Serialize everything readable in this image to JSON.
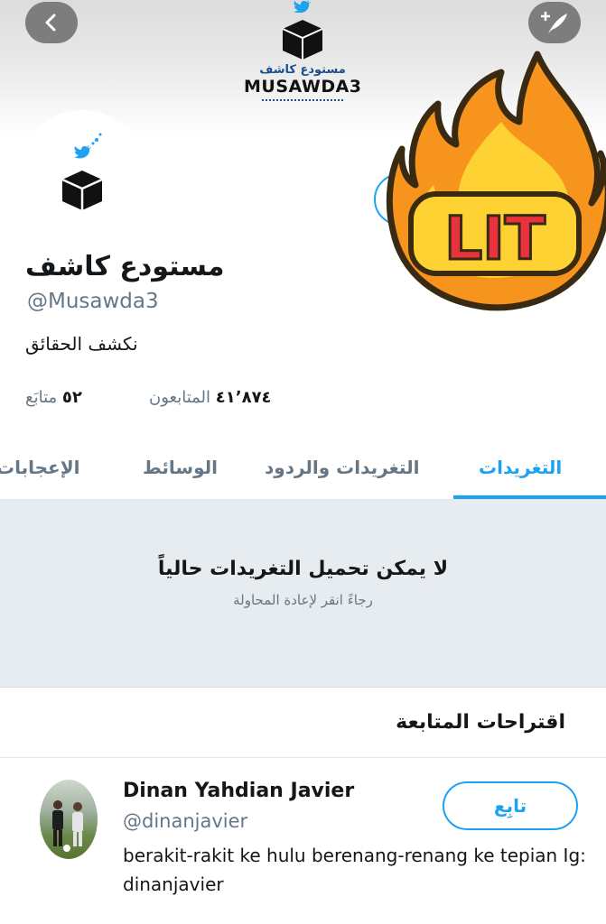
{
  "header": {
    "brand_arabic": "مستودع كاشف",
    "brand_latin": "MUSAWDA3",
    "back_icon": "chevron-left-icon",
    "compose_icon": "compose-tweet-icon"
  },
  "sticker": {
    "text": "LIT"
  },
  "profile": {
    "name": "مستودع كاشف",
    "handle": "@Musawda3",
    "bio": "نكشف الحقائق",
    "following_count": "٥٢",
    "following_label": "متابَع",
    "followers_count": "٤١٬٨٧٤",
    "followers_label": "المتابعون"
  },
  "tabs": [
    {
      "label": "التغريدات",
      "active": true
    },
    {
      "label": "التغريدات والردود",
      "active": false
    },
    {
      "label": "الوسائط",
      "active": false
    },
    {
      "label": "الإعجابات",
      "active": false
    }
  ],
  "empty_state": {
    "title": "لا يمكن تحميل التغريدات حالياً",
    "subtitle": "رجاءً انقر لإعادة المحاولة"
  },
  "suggestions": {
    "title": "اقتراحات المتابعة",
    "items": [
      {
        "name": "Dinan Yahdian Javier",
        "handle": "@dinanjavier",
        "bio": "berakit-rakit ke hulu berenang-renang ke tepian Ig: dinanjavier",
        "follow_label": "تابِع"
      }
    ]
  },
  "colors": {
    "accent": "#1da1f2",
    "muted": "#657786",
    "empty_bg": "#e6ecf0"
  }
}
